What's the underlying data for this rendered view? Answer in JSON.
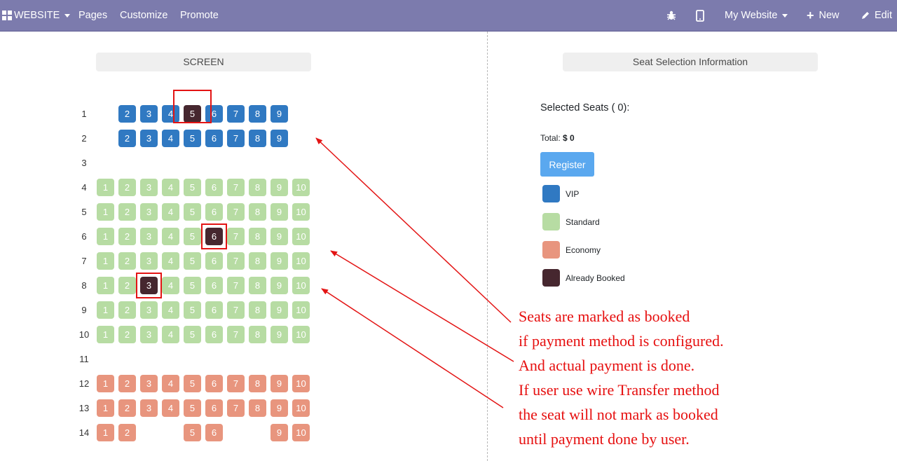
{
  "navbar": {
    "website_label": "WEBSITE",
    "pages_label": "Pages",
    "customize_label": "Customize",
    "promote_label": "Promote",
    "my_website_label": "My Website",
    "new_label": "New",
    "edit_label": "Edit"
  },
  "seat_map": {
    "screen_label": "SCREEN",
    "rows": [
      {
        "label": "1"
      },
      {
        "label": "2"
      },
      {
        "label": "3"
      },
      {
        "label": "4"
      },
      {
        "label": "5"
      },
      {
        "label": "6"
      },
      {
        "label": "7"
      },
      {
        "label": "8"
      },
      {
        "label": "9"
      },
      {
        "label": "10"
      },
      {
        "label": "11"
      },
      {
        "label": "12"
      },
      {
        "label": "13"
      },
      {
        "label": "14"
      }
    ],
    "seats": [
      {
        "row": 1,
        "col": 2,
        "text": "2",
        "cls": "vip"
      },
      {
        "row": 1,
        "col": 3,
        "text": "3",
        "cls": "vip"
      },
      {
        "row": 1,
        "col": 4,
        "text": "4",
        "cls": "vip"
      },
      {
        "row": 1,
        "col": 5,
        "text": "5",
        "cls": "booked"
      },
      {
        "row": 1,
        "col": 6,
        "text": "6",
        "cls": "vip"
      },
      {
        "row": 1,
        "col": 7,
        "text": "7",
        "cls": "vip"
      },
      {
        "row": 1,
        "col": 8,
        "text": "8",
        "cls": "vip"
      },
      {
        "row": 1,
        "col": 9,
        "text": "9",
        "cls": "vip"
      },
      {
        "row": 2,
        "col": 2,
        "text": "2",
        "cls": "vip"
      },
      {
        "row": 2,
        "col": 3,
        "text": "3",
        "cls": "vip"
      },
      {
        "row": 2,
        "col": 4,
        "text": "4",
        "cls": "vip"
      },
      {
        "row": 2,
        "col": 5,
        "text": "5",
        "cls": "vip"
      },
      {
        "row": 2,
        "col": 6,
        "text": "6",
        "cls": "vip"
      },
      {
        "row": 2,
        "col": 7,
        "text": "7",
        "cls": "vip"
      },
      {
        "row": 2,
        "col": 8,
        "text": "8",
        "cls": "vip"
      },
      {
        "row": 2,
        "col": 9,
        "text": "9",
        "cls": "vip"
      },
      {
        "row": 4,
        "col": 1,
        "text": "1",
        "cls": "standard"
      },
      {
        "row": 4,
        "col": 2,
        "text": "2",
        "cls": "standard"
      },
      {
        "row": 4,
        "col": 3,
        "text": "3",
        "cls": "standard"
      },
      {
        "row": 4,
        "col": 4,
        "text": "4",
        "cls": "standard"
      },
      {
        "row": 4,
        "col": 5,
        "text": "5",
        "cls": "standard"
      },
      {
        "row": 4,
        "col": 6,
        "text": "6",
        "cls": "standard"
      },
      {
        "row": 4,
        "col": 7,
        "text": "7",
        "cls": "standard"
      },
      {
        "row": 4,
        "col": 8,
        "text": "8",
        "cls": "standard"
      },
      {
        "row": 4,
        "col": 9,
        "text": "9",
        "cls": "standard"
      },
      {
        "row": 4,
        "col": 10,
        "text": "10",
        "cls": "standard"
      },
      {
        "row": 5,
        "col": 1,
        "text": "1",
        "cls": "standard"
      },
      {
        "row": 5,
        "col": 2,
        "text": "2",
        "cls": "standard"
      },
      {
        "row": 5,
        "col": 3,
        "text": "3",
        "cls": "standard"
      },
      {
        "row": 5,
        "col": 4,
        "text": "4",
        "cls": "standard"
      },
      {
        "row": 5,
        "col": 5,
        "text": "5",
        "cls": "standard"
      },
      {
        "row": 5,
        "col": 6,
        "text": "6",
        "cls": "standard"
      },
      {
        "row": 5,
        "col": 7,
        "text": "7",
        "cls": "standard"
      },
      {
        "row": 5,
        "col": 8,
        "text": "8",
        "cls": "standard"
      },
      {
        "row": 5,
        "col": 9,
        "text": "9",
        "cls": "standard"
      },
      {
        "row": 5,
        "col": 10,
        "text": "10",
        "cls": "standard"
      },
      {
        "row": 6,
        "col": 1,
        "text": "1",
        "cls": "standard"
      },
      {
        "row": 6,
        "col": 2,
        "text": "2",
        "cls": "standard"
      },
      {
        "row": 6,
        "col": 3,
        "text": "3",
        "cls": "standard"
      },
      {
        "row": 6,
        "col": 4,
        "text": "4",
        "cls": "standard"
      },
      {
        "row": 6,
        "col": 5,
        "text": "5",
        "cls": "standard"
      },
      {
        "row": 6,
        "col": 6,
        "text": "6",
        "cls": "booked"
      },
      {
        "row": 6,
        "col": 7,
        "text": "7",
        "cls": "standard"
      },
      {
        "row": 6,
        "col": 8,
        "text": "8",
        "cls": "standard"
      },
      {
        "row": 6,
        "col": 9,
        "text": "9",
        "cls": "standard"
      },
      {
        "row": 6,
        "col": 10,
        "text": "10",
        "cls": "standard"
      },
      {
        "row": 7,
        "col": 1,
        "text": "1",
        "cls": "standard"
      },
      {
        "row": 7,
        "col": 2,
        "text": "2",
        "cls": "standard"
      },
      {
        "row": 7,
        "col": 3,
        "text": "3",
        "cls": "standard"
      },
      {
        "row": 7,
        "col": 4,
        "text": "4",
        "cls": "standard"
      },
      {
        "row": 7,
        "col": 5,
        "text": "5",
        "cls": "standard"
      },
      {
        "row": 7,
        "col": 6,
        "text": "6",
        "cls": "standard"
      },
      {
        "row": 7,
        "col": 7,
        "text": "7",
        "cls": "standard"
      },
      {
        "row": 7,
        "col": 8,
        "text": "8",
        "cls": "standard"
      },
      {
        "row": 7,
        "col": 9,
        "text": "9",
        "cls": "standard"
      },
      {
        "row": 7,
        "col": 10,
        "text": "10",
        "cls": "standard"
      },
      {
        "row": 8,
        "col": 1,
        "text": "1",
        "cls": "standard"
      },
      {
        "row": 8,
        "col": 2,
        "text": "2",
        "cls": "standard"
      },
      {
        "row": 8,
        "col": 3,
        "text": "3",
        "cls": "booked"
      },
      {
        "row": 8,
        "col": 4,
        "text": "4",
        "cls": "standard"
      },
      {
        "row": 8,
        "col": 5,
        "text": "5",
        "cls": "standard"
      },
      {
        "row": 8,
        "col": 6,
        "text": "6",
        "cls": "standard"
      },
      {
        "row": 8,
        "col": 7,
        "text": "7",
        "cls": "standard"
      },
      {
        "row": 8,
        "col": 8,
        "text": "8",
        "cls": "standard"
      },
      {
        "row": 8,
        "col": 9,
        "text": "9",
        "cls": "standard"
      },
      {
        "row": 8,
        "col": 10,
        "text": "10",
        "cls": "standard"
      },
      {
        "row": 9,
        "col": 1,
        "text": "1",
        "cls": "standard"
      },
      {
        "row": 9,
        "col": 2,
        "text": "2",
        "cls": "standard"
      },
      {
        "row": 9,
        "col": 3,
        "text": "3",
        "cls": "standard"
      },
      {
        "row": 9,
        "col": 4,
        "text": "4",
        "cls": "standard"
      },
      {
        "row": 9,
        "col": 5,
        "text": "5",
        "cls": "standard"
      },
      {
        "row": 9,
        "col": 6,
        "text": "6",
        "cls": "standard"
      },
      {
        "row": 9,
        "col": 7,
        "text": "7",
        "cls": "standard"
      },
      {
        "row": 9,
        "col": 8,
        "text": "8",
        "cls": "standard"
      },
      {
        "row": 9,
        "col": 9,
        "text": "9",
        "cls": "standard"
      },
      {
        "row": 9,
        "col": 10,
        "text": "10",
        "cls": "standard"
      },
      {
        "row": 10,
        "col": 1,
        "text": "1",
        "cls": "standard"
      },
      {
        "row": 10,
        "col": 2,
        "text": "2",
        "cls": "standard"
      },
      {
        "row": 10,
        "col": 3,
        "text": "3",
        "cls": "standard"
      },
      {
        "row": 10,
        "col": 4,
        "text": "4",
        "cls": "standard"
      },
      {
        "row": 10,
        "col": 5,
        "text": "5",
        "cls": "standard"
      },
      {
        "row": 10,
        "col": 6,
        "text": "6",
        "cls": "standard"
      },
      {
        "row": 10,
        "col": 7,
        "text": "7",
        "cls": "standard"
      },
      {
        "row": 10,
        "col": 8,
        "text": "8",
        "cls": "standard"
      },
      {
        "row": 10,
        "col": 9,
        "text": "9",
        "cls": "standard"
      },
      {
        "row": 10,
        "col": 10,
        "text": "10",
        "cls": "standard"
      },
      {
        "row": 12,
        "col": 1,
        "text": "1",
        "cls": "economy"
      },
      {
        "row": 12,
        "col": 2,
        "text": "2",
        "cls": "economy"
      },
      {
        "row": 12,
        "col": 3,
        "text": "3",
        "cls": "economy"
      },
      {
        "row": 12,
        "col": 4,
        "text": "4",
        "cls": "economy"
      },
      {
        "row": 12,
        "col": 5,
        "text": "5",
        "cls": "economy"
      },
      {
        "row": 12,
        "col": 6,
        "text": "6",
        "cls": "economy"
      },
      {
        "row": 12,
        "col": 7,
        "text": "7",
        "cls": "economy"
      },
      {
        "row": 12,
        "col": 8,
        "text": "8",
        "cls": "economy"
      },
      {
        "row": 12,
        "col": 9,
        "text": "9",
        "cls": "economy"
      },
      {
        "row": 12,
        "col": 10,
        "text": "10",
        "cls": "economy"
      },
      {
        "row": 13,
        "col": 1,
        "text": "1",
        "cls": "economy"
      },
      {
        "row": 13,
        "col": 2,
        "text": "2",
        "cls": "economy"
      },
      {
        "row": 13,
        "col": 3,
        "text": "3",
        "cls": "economy"
      },
      {
        "row": 13,
        "col": 4,
        "text": "4",
        "cls": "economy"
      },
      {
        "row": 13,
        "col": 5,
        "text": "5",
        "cls": "economy"
      },
      {
        "row": 13,
        "col": 6,
        "text": "6",
        "cls": "economy"
      },
      {
        "row": 13,
        "col": 7,
        "text": "7",
        "cls": "economy"
      },
      {
        "row": 13,
        "col": 8,
        "text": "8",
        "cls": "economy"
      },
      {
        "row": 13,
        "col": 9,
        "text": "9",
        "cls": "economy"
      },
      {
        "row": 13,
        "col": 10,
        "text": "10",
        "cls": "economy"
      },
      {
        "row": 14,
        "col": 1,
        "text": "1",
        "cls": "economy"
      },
      {
        "row": 14,
        "col": 2,
        "text": "2",
        "cls": "economy"
      },
      {
        "row": 14,
        "col": 5,
        "text": "5",
        "cls": "economy"
      },
      {
        "row": 14,
        "col": 6,
        "text": "6",
        "cls": "economy"
      },
      {
        "row": 14,
        "col": 9,
        "text": "9",
        "cls": "economy"
      },
      {
        "row": 14,
        "col": 10,
        "text": "10",
        "cls": "economy"
      }
    ],
    "highlighted": [
      {
        "row": 1,
        "col": 5
      },
      {
        "row": 6,
        "col": 6
      },
      {
        "row": 8,
        "col": 3
      }
    ]
  },
  "info": {
    "title": "Seat Selection Information",
    "selected_seats_label": "Selected Seats ( 0):",
    "total_label": "Total:",
    "total_value": "$ 0",
    "register_label": "Register",
    "legend": [
      {
        "label": "VIP",
        "color": "#3079c2"
      },
      {
        "label": "Standard",
        "color": "#b7dca3"
      },
      {
        "label": "Economy",
        "color": "#e8957e"
      },
      {
        "label": "Already Booked",
        "color": "#46272f"
      }
    ]
  },
  "annotation": {
    "color": "#e60f0f",
    "lines": [
      "Seats are marked as booked",
      "if payment method is configured.",
      "And actual payment is done.",
      "If user use wire Transfer method",
      "the seat will not mark as booked",
      "until payment done by user."
    ]
  }
}
